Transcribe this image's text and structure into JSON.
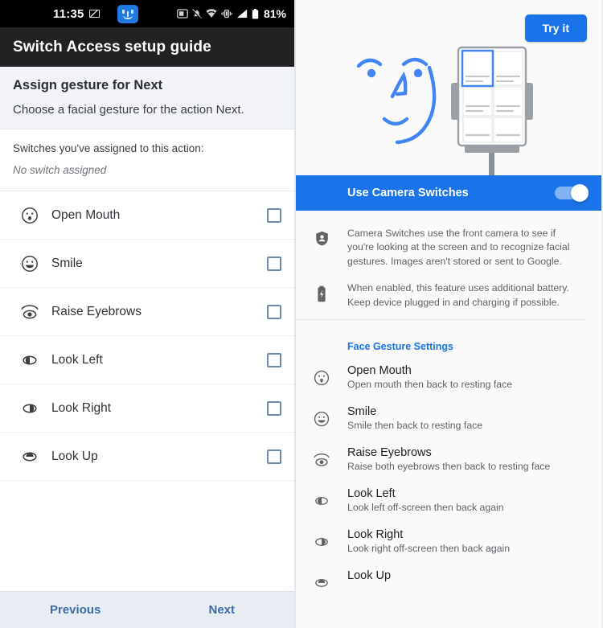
{
  "left": {
    "statusbar": {
      "time": "11:35",
      "message_icon": "message-icon",
      "app_face_icon": "face-app-icon",
      "icons": [
        "screenshot-icon",
        "notifications-muted-icon",
        "wifi-icon",
        "vibrate-icon",
        "signal-icon",
        "battery-icon"
      ],
      "battery_percent": "81%"
    },
    "appbar": {
      "title": "Switch Access setup guide"
    },
    "section": {
      "title": "Assign gesture for Next",
      "subtitle": "Choose a facial gesture for the action Next."
    },
    "assigned": {
      "label": "Switches you've assigned to this action:",
      "value": "No switch assigned"
    },
    "gestures": [
      {
        "icon": "open-mouth-icon",
        "label": "Open Mouth",
        "checked": false
      },
      {
        "icon": "smile-icon",
        "label": "Smile",
        "checked": false
      },
      {
        "icon": "raise-eyebrows-icon",
        "label": "Raise Eyebrows",
        "checked": false
      },
      {
        "icon": "look-left-icon",
        "label": "Look Left",
        "checked": false
      },
      {
        "icon": "look-right-icon",
        "label": "Look Right",
        "checked": false
      },
      {
        "icon": "look-up-icon",
        "label": "Look Up",
        "checked": false
      }
    ],
    "bottombar": {
      "previous": "Previous",
      "next": "Next"
    }
  },
  "right": {
    "hero": {
      "try_button": "Try it",
      "illustration": "face-and-phone-on-stand-illustration"
    },
    "toggle": {
      "label": "Use Camera Switches",
      "state": "on"
    },
    "info": [
      {
        "icon": "privacy-shield-icon",
        "text": "Camera Switches use the front camera to see if you're looking at the screen and to recognize facial gestures. Images aren't stored or sent to Google."
      },
      {
        "icon": "battery-charging-icon",
        "text": "When enabled, this feature uses additional battery. Keep device plugged in and charging if possible."
      }
    ],
    "settings_title": "Face Gesture Settings",
    "gestures": [
      {
        "icon": "open-mouth-icon",
        "title": "Open Mouth",
        "subtitle": "Open mouth then back to resting face"
      },
      {
        "icon": "smile-icon",
        "title": "Smile",
        "subtitle": "Smile then back to resting face"
      },
      {
        "icon": "raise-eyebrows-icon",
        "title": "Raise Eyebrows",
        "subtitle": "Raise both eyebrows then back to resting face"
      },
      {
        "icon": "look-left-icon",
        "title": "Look Left",
        "subtitle": "Look left off-screen then back again"
      },
      {
        "icon": "look-right-icon",
        "title": "Look Right",
        "subtitle": "Look right off-screen then back again"
      },
      {
        "icon": "look-up-icon",
        "title": "Look Up",
        "subtitle": ""
      }
    ]
  },
  "colors": {
    "accent_blue": "#1a73e8",
    "appbar_dark": "#222222",
    "statusbar_black": "#000000",
    "checkbox_outline": "#6b8cb0",
    "link_blue": "#3c6ca8",
    "illustration_blue": "#4285f4",
    "device_gray": "#9aa0a6"
  }
}
